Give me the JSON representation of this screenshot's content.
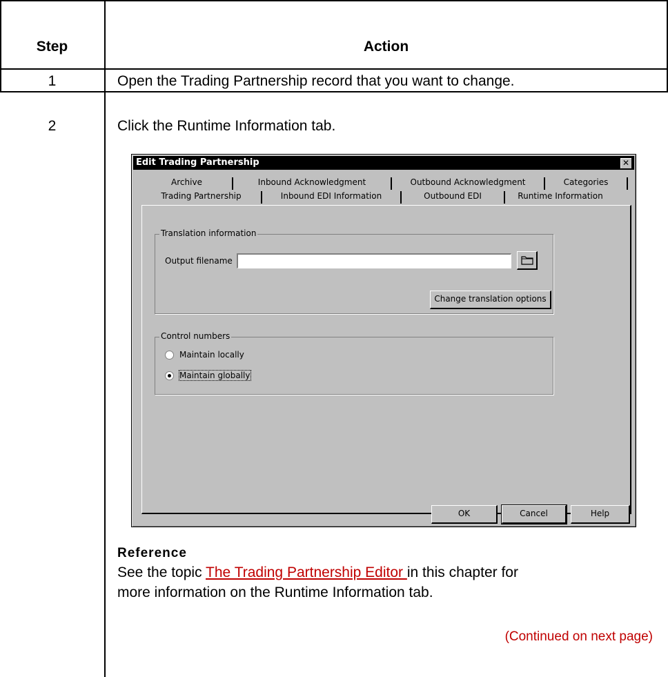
{
  "table": {
    "header_step": "Step",
    "header_action": "Action",
    "rows": [
      {
        "step": "1",
        "action": "Open the Trading Partnership record that you want to change."
      },
      {
        "step": "2",
        "action": "Click the Runtime Information tab."
      }
    ]
  },
  "dialog": {
    "title": "Edit Trading Partnership",
    "close_glyph": "✕",
    "tabs_row1": [
      "Archive",
      "Inbound Acknowledgment",
      "Outbound Acknowledgment",
      "Categories"
    ],
    "tabs_row2": [
      "Trading Partnership",
      "Inbound EDI Information",
      "Outbound EDI",
      "Runtime Information"
    ],
    "translation": {
      "group_label": "Translation information",
      "output_label": "Output filename",
      "output_value": "",
      "change_button": "Change translation options"
    },
    "control": {
      "group_label": "Control numbers",
      "option_local": "Maintain locally",
      "option_global": "Maintain globally",
      "selected": "Maintain globally"
    },
    "buttons": {
      "ok": "OK",
      "cancel": "Cancel",
      "help": "Help"
    }
  },
  "reference": {
    "title": "Reference",
    "text_before": "See the topic ",
    "link": "The Trading Partnership Editor ",
    "text_after": "in this chapter for",
    "line2": "more information on the Runtime Information tab."
  },
  "continued": "(Continued on next page)"
}
